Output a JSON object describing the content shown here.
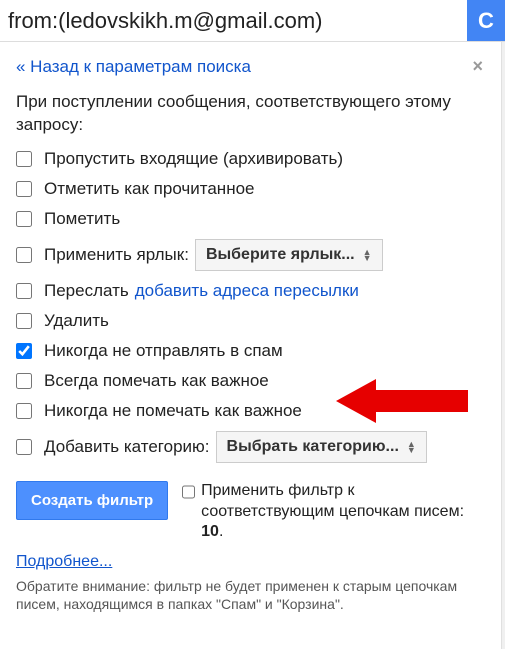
{
  "search": {
    "value": "from:(ledovskikh.m@gmail.com)",
    "button_glyph": "C"
  },
  "panel": {
    "back_link": "« Назад к параметрам поиска",
    "close_glyph": "×",
    "intro": "При поступлении сообщения, соответствующего этому запросу:",
    "options": {
      "skip_inbox": "Пропустить входящие (архивировать)",
      "mark_read": "Отметить как прочитанное",
      "star": "Пометить",
      "apply_label": "Применить ярлык:",
      "apply_label_select": "Выберите ярлык...",
      "forward": "Переслать",
      "forward_link": "добавить адреса пересылки",
      "delete": "Удалить",
      "never_spam": "Никогда не отправлять в спам",
      "always_important": "Всегда помечать как важное",
      "never_important": "Никогда не помечать как важное",
      "add_category": "Добавить категорию:",
      "add_category_select": "Выбрать категорию..."
    },
    "create_button": "Создать фильтр",
    "apply_existing_pre": "Применить фильтр к соответствующим цепочкам писем: ",
    "apply_existing_count": "10",
    "apply_existing_post": ".",
    "more_link": "Подробнее...",
    "note": "Обратите внимание: фильтр не будет применен к старым цепочкам писем, находящимся в папках \"Спам\" и \"Корзина\"."
  }
}
